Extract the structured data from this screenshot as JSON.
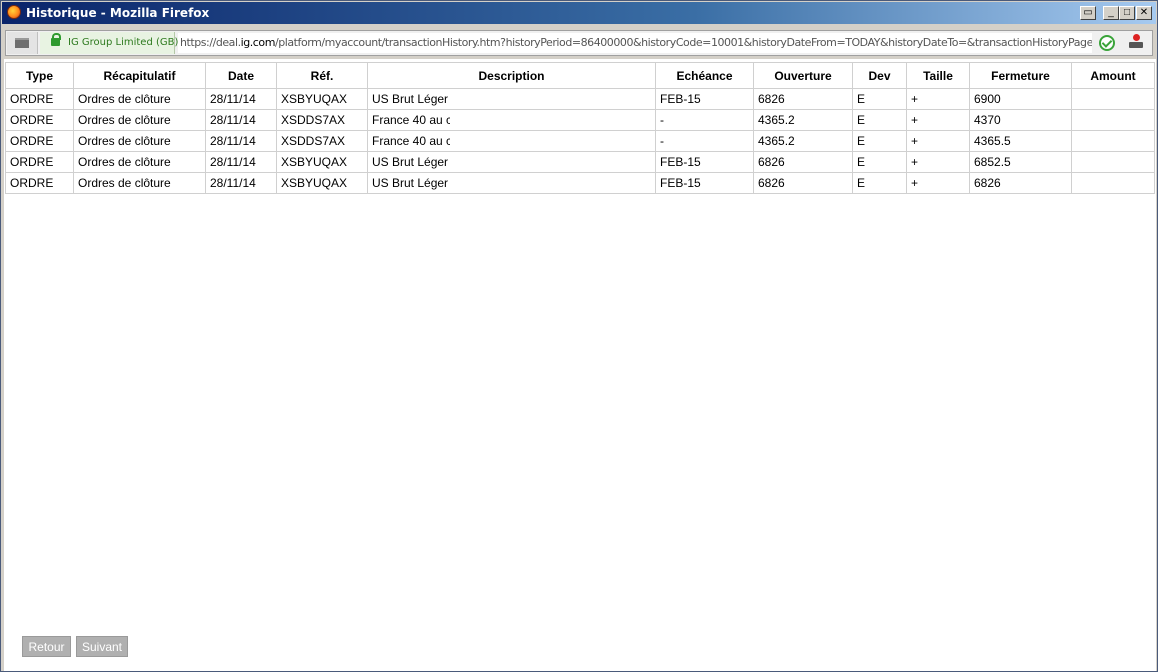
{
  "window": {
    "title": "Historique - Mozilla Firefox"
  },
  "urlbar": {
    "identity": "IG Group Limited (GB)",
    "url_prefix": "https://deal.",
    "url_domain": "ig.com",
    "url_suffix": "/platform/myaccount/transactionHistory.htm?historyPeriod=86400000&historyCode=10001&historyDateFrom=TODAY&historyDateTo=&transactionHistoryPageNumber=1"
  },
  "table": {
    "headers": [
      "Type",
      "Récapitulatif",
      "Date",
      "Réf.",
      "Description",
      "Echéance",
      "Ouverture",
      "Dev",
      "Taille",
      "Fermeture",
      "Amount"
    ],
    "rows": [
      {
        "type": "ORDRE",
        "recap": "Ordres de clôture",
        "date": "28/11/14",
        "ref": "XSBYUQAX",
        "description": "US Brut Léger",
        "echeance": "FEB-15",
        "ouverture": "6826",
        "dev": "E",
        "taille": "+",
        "fermeture": "6900",
        "amount": ""
      },
      {
        "type": "ORDRE",
        "recap": "Ordres de clôture",
        "date": "28/11/14",
        "ref": "XSDDS7AX",
        "description": "France 40 au c",
        "echeance": "-",
        "ouverture": "4365.2",
        "dev": "E",
        "taille": "+",
        "fermeture": "4370",
        "amount": ""
      },
      {
        "type": "ORDRE",
        "recap": "Ordres de clôture",
        "date": "28/11/14",
        "ref": "XSDDS7AX",
        "description": "France 40 au c",
        "echeance": "-",
        "ouverture": "4365.2",
        "dev": "E",
        "taille": "+",
        "fermeture": "4365.5",
        "amount": ""
      },
      {
        "type": "ORDRE",
        "recap": "Ordres de clôture",
        "date": "28/11/14",
        "ref": "XSBYUQAX",
        "description": "US Brut Léger",
        "echeance": "FEB-15",
        "ouverture": "6826",
        "dev": "E",
        "taille": "+",
        "fermeture": "6852.5",
        "amount": ""
      },
      {
        "type": "ORDRE",
        "recap": "Ordres de clôture",
        "date": "28/11/14",
        "ref": "XSBYUQAX",
        "description": "US Brut Léger",
        "echeance": "FEB-15",
        "ouverture": "6826",
        "dev": "E",
        "taille": "+",
        "fermeture": "6826",
        "amount": ""
      }
    ]
  },
  "pagination": {
    "back_label": "Retour",
    "next_label": "Suivant"
  },
  "colors": {
    "titlebar": "#0a246a",
    "button_disabled": "#b0b0b0",
    "identity_green": "#2d7a1e"
  },
  "icons": {
    "app": "firefox-icon",
    "secure": "lock-icon",
    "verified": "check-icon",
    "notifications": "notification-icon"
  }
}
